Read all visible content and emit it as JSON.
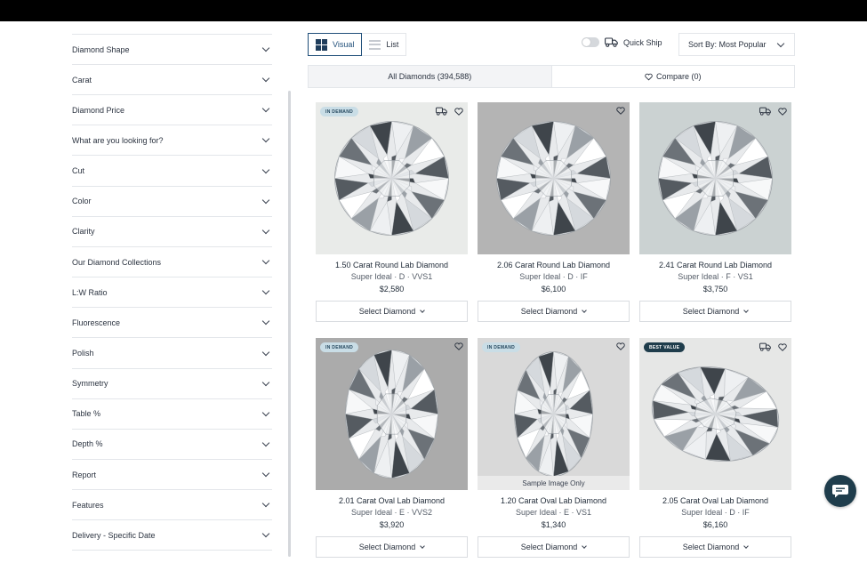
{
  "filters": [
    "Diamond Shape",
    "Carat",
    "Diamond Price",
    "What are you looking for?",
    "Cut",
    "Color",
    "Clarity",
    "Our Diamond Collections",
    "L:W Ratio",
    "Fluorescence",
    "Polish",
    "Symmetry",
    "Table %",
    "Depth %",
    "Report",
    "Features",
    "Delivery - Specific Date"
  ],
  "toolbar": {
    "view_visual": "Visual",
    "view_list": "List",
    "quick_ship": "Quick Ship",
    "sort": "Sort By: Most Popular"
  },
  "tabs": {
    "all": "All Diamonds (394,588)",
    "compare": "Compare (0)"
  },
  "cards": [
    {
      "title": "1.50 Carat Round Lab Diamond",
      "sub": "Super Ideal · D · VVS1",
      "price": "$2,580",
      "badge": "IN DEMAND",
      "badge_type": "demand",
      "quick_ship": true,
      "shape": "round",
      "bg": "#e9ebe9",
      "sample": ""
    },
    {
      "title": "2.06 Carat Round Lab Diamond",
      "sub": "Super Ideal · D · IF",
      "price": "$6,100",
      "badge": "",
      "badge_type": "",
      "quick_ship": false,
      "shape": "round",
      "bg": "#b4b4b4",
      "sample": ""
    },
    {
      "title": "2.41 Carat Round Lab Diamond",
      "sub": "Super Ideal · F · VS1",
      "price": "$3,750",
      "badge": "",
      "badge_type": "",
      "quick_ship": true,
      "shape": "round",
      "bg": "#cbd2d2",
      "sample": ""
    },
    {
      "title": "2.01 Carat Oval Lab Diamond",
      "sub": "Super Ideal · E · VVS2",
      "price": "$3,920",
      "badge": "IN DEMAND",
      "badge_type": "demand",
      "quick_ship": false,
      "shape": "oval",
      "bg": "#ababab",
      "sample": ""
    },
    {
      "title": "1.20 Carat Oval Lab Diamond",
      "sub": "Super Ideal · E · VS1",
      "price": "$1,340",
      "badge": "IN DEMAND",
      "badge_type": "demand",
      "quick_ship": false,
      "shape": "oval-narrow",
      "bg": "#d9d9d9",
      "sample": "Sample Image Only"
    },
    {
      "title": "2.05 Carat Oval Lab Diamond",
      "sub": "Super Ideal · D · IF",
      "price": "$6,160",
      "badge": "BEST VALUE",
      "badge_type": "value",
      "quick_ship": true,
      "shape": "oval-tilt",
      "bg": "#e6e7e6",
      "sample": ""
    }
  ],
  "select_label": "Select Diamond",
  "colors": {
    "accent": "#1f4e79",
    "badge_demand": "#c9dde6",
    "badge_value": "#1f3d4c"
  }
}
